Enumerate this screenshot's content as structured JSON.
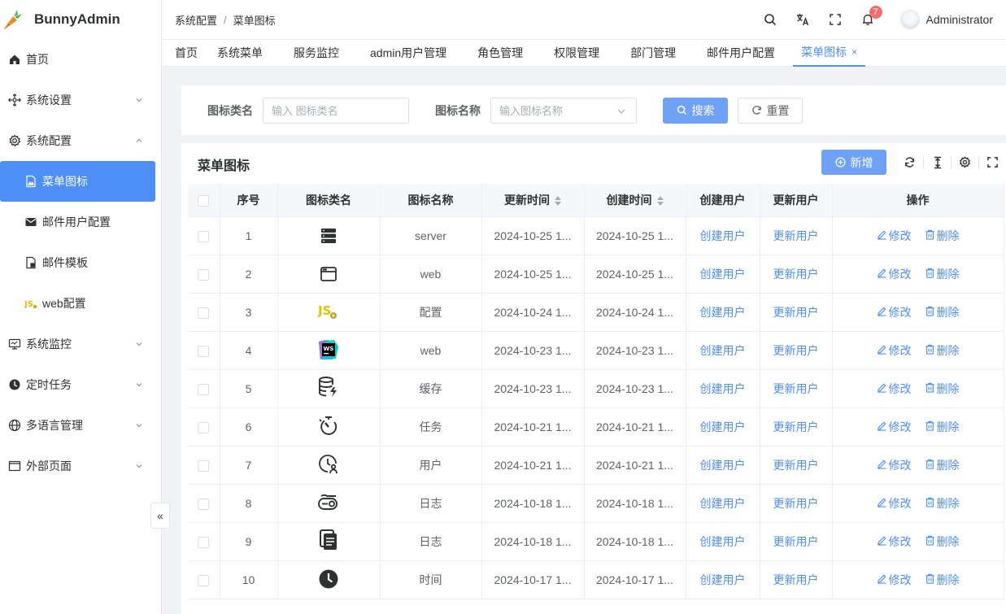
{
  "app": {
    "name": "BunnyAdmin"
  },
  "sidebar": {
    "items": [
      {
        "label": "首页",
        "icon": "home-icon"
      },
      {
        "label": "系统设置",
        "icon": "settings-cross-icon"
      },
      {
        "label": "系统配置",
        "icon": "gear-icon",
        "expanded": true
      },
      {
        "label": "菜单图标",
        "icon": "image-file-icon",
        "active": true,
        "sub": true
      },
      {
        "label": "邮件用户配置",
        "icon": "mail-icon",
        "sub": true
      },
      {
        "label": "邮件模板",
        "icon": "template-icon",
        "sub": true
      },
      {
        "label": "web配置",
        "icon": "js-icon",
        "sub": true
      },
      {
        "label": "系统监控",
        "icon": "monitor-icon"
      },
      {
        "label": "定时任务",
        "icon": "clock-icon"
      },
      {
        "label": "多语言管理",
        "icon": "globe-icon"
      },
      {
        "label": "外部页面",
        "icon": "window-icon"
      }
    ],
    "collapse_glyph": "«"
  },
  "header": {
    "breadcrumb": [
      "系统配置",
      "菜单图标"
    ],
    "notification_count": "7",
    "username": "Administrator"
  },
  "tabs": [
    {
      "label": "首页"
    },
    {
      "label": "系统菜单"
    },
    {
      "label": "服务监控"
    },
    {
      "label": "admin用户管理"
    },
    {
      "label": "角色管理"
    },
    {
      "label": "权限管理"
    },
    {
      "label": "部门管理"
    },
    {
      "label": "邮件用户配置"
    },
    {
      "label": "菜单图标",
      "active": true,
      "close": "×"
    }
  ],
  "search": {
    "class_label": "图标类名",
    "class_placeholder": "输入 图标类名",
    "name_label": "图标名称",
    "name_placeholder": "输入图标名称",
    "search_button": "搜索",
    "reset_button": "重置"
  },
  "table": {
    "title": "菜单图标",
    "add_button": "新增",
    "columns": [
      "序号",
      "图标类名",
      "图标名称",
      "更新时间",
      "创建时间",
      "创建用户",
      "更新用户",
      "操作"
    ],
    "edit_label": "修改",
    "delete_label": "删除",
    "rows": [
      {
        "no": "1",
        "icon": "server-icon",
        "name": "server",
        "updated": "2024-10-25 1...",
        "created": "2024-10-25 1...",
        "creator": "创建用户",
        "updater": "更新用户"
      },
      {
        "no": "2",
        "icon": "browser-window-icon",
        "name": "web",
        "updated": "2024-10-25 1...",
        "created": "2024-10-25 1...",
        "creator": "创建用户",
        "updater": "更新用户"
      },
      {
        "no": "3",
        "icon": "js-gear-icon",
        "name": "配置",
        "updated": "2024-10-24 1...",
        "created": "2024-10-24 1...",
        "creator": "创建用户",
        "updater": "更新用户"
      },
      {
        "no": "4",
        "icon": "webstorm-icon",
        "name": "web",
        "updated": "2024-10-23 1...",
        "created": "2024-10-23 1...",
        "creator": "创建用户",
        "updater": "更新用户"
      },
      {
        "no": "5",
        "icon": "database-bolt-icon",
        "name": "缓存",
        "updated": "2024-10-23 1...",
        "created": "2024-10-23 1...",
        "creator": "创建用户",
        "updater": "更新用户"
      },
      {
        "no": "6",
        "icon": "timer-icon",
        "name": "任务",
        "updated": "2024-10-21 1...",
        "created": "2024-10-21 1...",
        "creator": "创建用户",
        "updater": "更新用户"
      },
      {
        "no": "7",
        "icon": "clock-user-icon",
        "name": "用户",
        "updated": "2024-10-21 1...",
        "created": "2024-10-21 1...",
        "creator": "创建用户",
        "updater": "更新用户"
      },
      {
        "no": "8",
        "icon": "log-icon",
        "name": "日志",
        "updated": "2024-10-18 1...",
        "created": "2024-10-18 1...",
        "creator": "创建用户",
        "updater": "更新用户"
      },
      {
        "no": "9",
        "icon": "documents-icon",
        "name": "日志",
        "updated": "2024-10-18 1...",
        "created": "2024-10-18 1...",
        "creator": "创建用户",
        "updater": "更新用户"
      },
      {
        "no": "10",
        "icon": "clock-filled-icon",
        "name": "时间",
        "updated": "2024-10-17 1...",
        "created": "2024-10-17 1...",
        "creator": "创建用户",
        "updater": "更新用户"
      }
    ]
  },
  "colors": {
    "primary": "#4e8ef7",
    "primary_light": "#6fa2f7",
    "badge": "#f56c6c"
  }
}
